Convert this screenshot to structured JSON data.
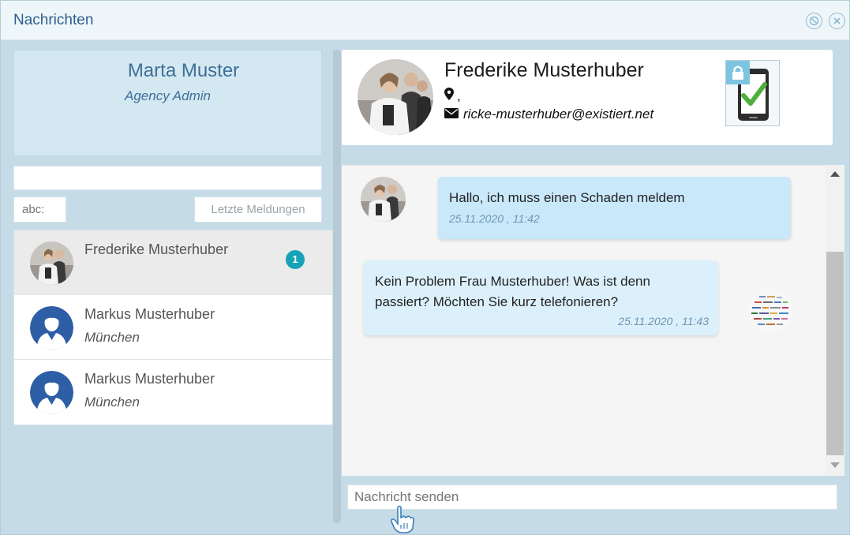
{
  "window": {
    "title": "Nachrichten",
    "controls": [
      "minimize-icon",
      "close-icon"
    ]
  },
  "profile": {
    "name": "Marta Muster",
    "role": "Agency Admin"
  },
  "filter": {
    "placeholder": "abc:",
    "latest_label": "Letzte Meldungen"
  },
  "contacts": [
    {
      "name": "Frederike Musterhuber",
      "city": "",
      "unread": "1",
      "avatar": "photo-avatar"
    },
    {
      "name": "Markus Musterhuber",
      "city": "München",
      "unread": "",
      "avatar": "user-avatar-icon"
    },
    {
      "name": "Markus Musterhuber",
      "city": "München",
      "unread": "",
      "avatar": "user-avatar-icon"
    }
  ],
  "chat_header": {
    "name": "Frederike Musterhuber",
    "location": ",",
    "email": "ricke-musterhuber@existiert.net",
    "device_icon": "secure-phone-check-icon"
  },
  "messages": [
    {
      "direction": "incoming",
      "text": "Hallo, ich muss einen Schaden meldem",
      "time": "25.11.2020 , 11:42"
    },
    {
      "direction": "outgoing",
      "text": "Kein Problem Frau Musterhuber! Was ist denn passiert? Möchten Sie kurz telefonieren?",
      "time": "25.11.2020 , 11:43"
    }
  ],
  "composer": {
    "placeholder": "Nachricht senden"
  },
  "colors": {
    "accent": "#17a2b8",
    "title": "#2f5f8f",
    "incoming_bubble": "#c9e8fa",
    "outgoing_bubble": "#dcf0fb",
    "avatar_blue": "#2e5fa6"
  }
}
